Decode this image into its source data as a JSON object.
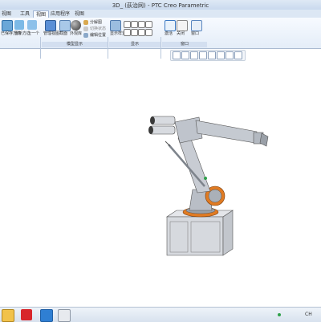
{
  "window": {
    "title": "3D_ (荻治网) - PTC Creo Parametric"
  },
  "tabs": [
    "视图",
    "工具",
    "视图",
    "应用程序",
    "视图"
  ],
  "ribbon": {
    "buttons": [
      {
        "label": "已保存方向"
      },
      {
        "label": "重新方向"
      },
      {
        "label": "上一个"
      },
      {
        "label": "管理视图"
      },
      {
        "label": "截面"
      },
      {
        "label": "外观库"
      },
      {
        "label": "分解图"
      },
      {
        "label": "切换状态"
      },
      {
        "label": "编辑位置"
      },
      {
        "label": "显示样式"
      },
      {
        "label": "激活"
      },
      {
        "label": "关闭"
      },
      {
        "label": "窗口"
      }
    ],
    "groups": [
      "模型显示",
      "显示",
      "窗口"
    ]
  },
  "viewbar": {
    "icons": [
      "zoom-fit-icon",
      "zoom-in-icon",
      "zoom-out-icon",
      "repaint-icon",
      "view-orient-icon",
      "saved-views-icon",
      "display-style-icon",
      "datum-display-icon"
    ]
  },
  "taskbar": {
    "apps": [
      "folder-icon",
      "pdf-icon",
      "app-icon",
      "creo-icon"
    ],
    "tray_text": "CH"
  }
}
